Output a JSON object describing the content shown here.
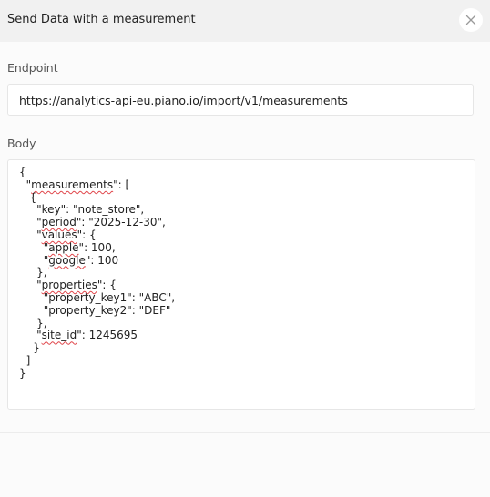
{
  "dialog": {
    "title": "Send Data with a measurement",
    "close_icon": "close-icon"
  },
  "endpoint": {
    "label": "Endpoint",
    "value": "https://analytics-api-eu.piano.io/import/v1/measurements"
  },
  "body": {
    "label": "Body",
    "lines": [
      "{",
      "  \"measurements\": [",
      "   {",
      "     \"key\": \"note_store\",",
      "     \"period\": \"2025-12-30\",",
      "     \"values\": {",
      "       \"apple\": 100,",
      "       \"google\": 100",
      "     },",
      "     \"properties\": {",
      "       \"property_key1\": \"ABC\",",
      "       \"property_key2\": \"DEF\"",
      "     },",
      "     \"site_id\": 1245695",
      "    }",
      "  ]",
      "}"
    ],
    "spellcheck_flagged_words": [
      "measurements",
      "period",
      "values",
      "apple",
      "google",
      "properties",
      "site_id"
    ]
  },
  "colors": {
    "header_bg": "#f1f1f1",
    "page_bg": "#fbfbfb",
    "spellcheck_underline": "#e0454a"
  }
}
